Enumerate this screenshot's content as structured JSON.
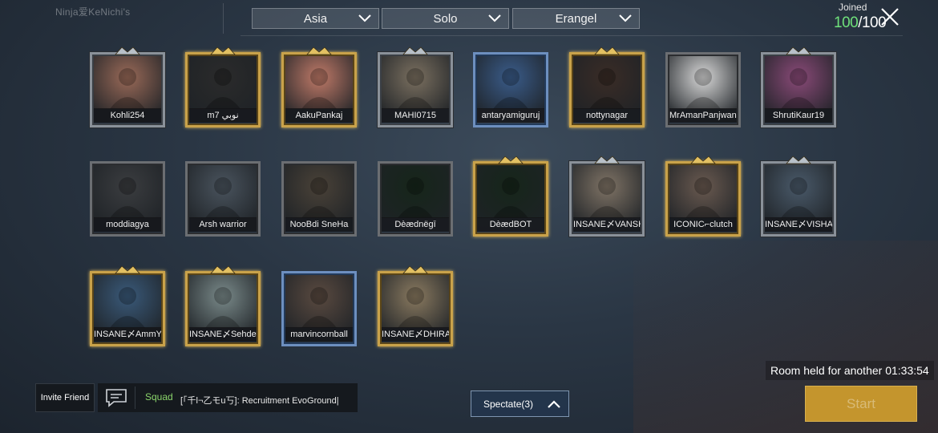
{
  "watermark": "Ninja爱KeNichi's",
  "filters": {
    "region": "Asia",
    "mode": "Solo",
    "map": "Erangel"
  },
  "joined": {
    "label": "Joined",
    "current": "100",
    "separator": "/",
    "total": "100"
  },
  "players": [
    {
      "name": "Kohli254",
      "frame": "silver",
      "photo": "#9a6a58"
    },
    {
      "name": "m7 نوبي",
      "frame": "gold",
      "photo": "#2b2b2b"
    },
    {
      "name": "AakuPankaj",
      "frame": "gold",
      "photo": "#c07a68"
    },
    {
      "name": "MAHI0715",
      "frame": "silver",
      "photo": "#7b7060"
    },
    {
      "name": "antaryamiguruj",
      "frame": "blue",
      "photo": "#3a5c8a"
    },
    {
      "name": "nottynagar",
      "frame": "gold",
      "photo": "#3a2c26"
    },
    {
      "name": "MrAmanPanjwani",
      "frame": "plain",
      "photo": "#d8d8d8"
    },
    {
      "name": "ShrutiKaur19",
      "frame": "silver",
      "photo": "#8a4a78"
    },
    {
      "name": "moddiagya",
      "frame": "plain",
      "photo": "#3b3d40"
    },
    {
      "name": "Arsh warrior",
      "frame": "plain",
      "photo": "#4a545e"
    },
    {
      "name": "NooBdi SneHa",
      "frame": "plain",
      "photo": "#4a4238"
    },
    {
      "name": "Dèædnëgī",
      "frame": "plain",
      "photo": "#16261a"
    },
    {
      "name": "DèædBOT",
      "frame": "gold",
      "photo": "#16261a"
    },
    {
      "name": "INSANE〆VANSH",
      "frame": "silver",
      "photo": "#807466"
    },
    {
      "name": "ICONIC⌐clutch",
      "frame": "gold",
      "photo": "#6a5a50"
    },
    {
      "name": "INSANE〆VISHAL",
      "frame": "silver",
      "photo": "#4a5a6a"
    },
    {
      "name": "INSANE〆AmmY",
      "frame": "gold",
      "photo": "#3a5a7a"
    },
    {
      "name": "INSANE〆Sehdev",
      "frame": "gold",
      "photo": "#7a8a8a"
    },
    {
      "name": "marvincornball",
      "frame": "blue",
      "photo": "#5a4a40"
    },
    {
      "name": "INSANE〆DHIRAj",
      "frame": "gold",
      "photo": "#8a7a60"
    }
  ],
  "chat": {
    "invite_label": "Invite Friend",
    "channel": "Squad",
    "message": "[「千l¬乙モu丂]: Recruitment EvoGround|"
  },
  "spectate_label": "Spectate(3)",
  "room_held": "Room held for another 01:33:54",
  "start_label": "Start",
  "colors": {
    "accent_gold": "#c4952d",
    "joined_green": "#6fe07a",
    "squad_green": "#8ad46b"
  },
  "icons": {
    "close": "close-icon",
    "chevron": "chevron-down-icon",
    "chat": "chat-icon",
    "caret": "chevron-up-icon"
  }
}
